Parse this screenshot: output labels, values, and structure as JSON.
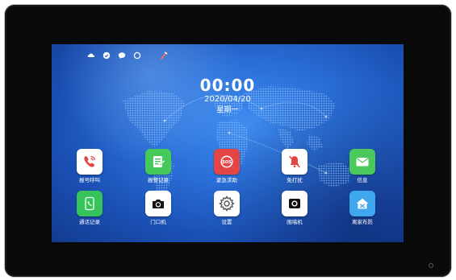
{
  "clock": {
    "time": "00:00",
    "date": "2020/04/20",
    "weekday": "星期一"
  },
  "status_bar": {
    "icons": [
      "cloud-icon",
      "shield-icon",
      "chat-icon",
      "ring-icon",
      "mute-brush-icon"
    ]
  },
  "apps": [
    {
      "label": "报号呼叫",
      "icon": "phone-call-icon",
      "color": "#ffffff"
    },
    {
      "label": "报警记录",
      "icon": "alarm-record-icon",
      "color": "#44c95a"
    },
    {
      "label": "紧急求助",
      "icon": "sos-icon",
      "color": "#e64545"
    },
    {
      "label": "免打扰",
      "icon": "do-not-disturb-bell-icon",
      "color": "#ffffff"
    },
    {
      "label": "信息",
      "icon": "envelope-icon",
      "color": "#4cc95c"
    },
    {
      "label": "通话记录",
      "icon": "call-log-icon",
      "color": "#36c45a"
    },
    {
      "label": "门口机",
      "icon": "door-camera-icon",
      "color": "#ffffff"
    },
    {
      "label": "设置",
      "icon": "gear-icon",
      "color": "#ffffff"
    },
    {
      "label": "围墙机",
      "icon": "wall-camera-icon",
      "color": "#ffffff"
    },
    {
      "label": "离家布防",
      "icon": "home-arm-icon",
      "color": "#3fa6f0"
    }
  ],
  "colors": {
    "bezel": "#090909",
    "screen_bg": "#2a6fd8",
    "text": "#ffffff"
  }
}
